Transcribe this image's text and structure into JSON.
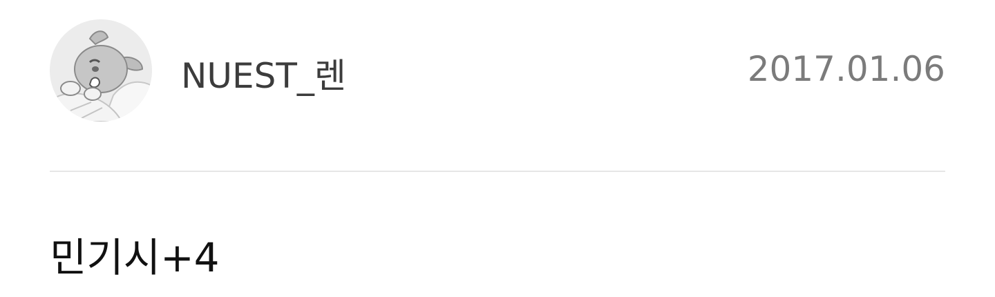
{
  "post": {
    "author": {
      "avatar_icon": "sleeping-cat-avatar-icon",
      "name": "NUEST_렌"
    },
    "date": "2017.01.06",
    "title": "민기시+4"
  },
  "colors": {
    "name_text": "#3c3c3c",
    "date_text": "#7b7b7b",
    "title_text": "#111111",
    "divider": "#e6e6e6",
    "avatar_bg": "#ececec"
  }
}
